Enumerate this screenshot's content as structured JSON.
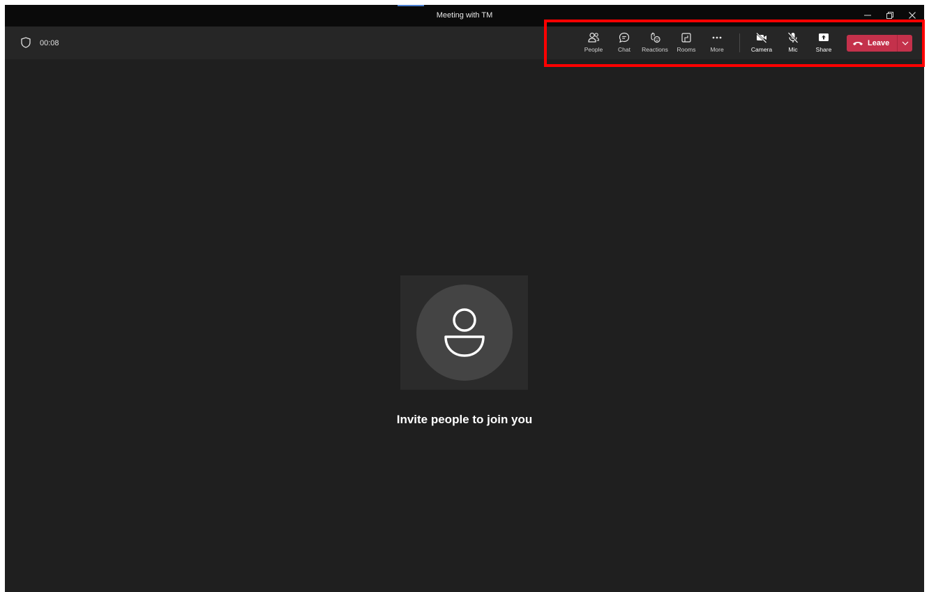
{
  "window": {
    "title": "Meeting with TM",
    "controls": {
      "minimize": "minimize-icon",
      "restore": "restore-icon",
      "close": "close-icon"
    }
  },
  "toolbar": {
    "timer": "00:08",
    "items": [
      {
        "label": "People",
        "icon": "people-icon"
      },
      {
        "label": "Chat",
        "icon": "chat-icon"
      },
      {
        "label": "Reactions",
        "icon": "reactions-icon"
      },
      {
        "label": "Rooms",
        "icon": "rooms-icon"
      },
      {
        "label": "More",
        "icon": "more-icon"
      },
      {
        "label": "Camera",
        "icon": "camera-off-icon"
      },
      {
        "label": "Mic",
        "icon": "mic-off-icon"
      },
      {
        "label": "Share",
        "icon": "share-icon"
      }
    ],
    "leave": {
      "label": "Leave",
      "icon": "hang-up-icon"
    }
  },
  "stage": {
    "message": "Invite people to join you"
  },
  "colors": {
    "leave": "#c4314b",
    "background": "#1f1f1f",
    "toolbar": "#262626",
    "highlight": "#ff0000"
  }
}
